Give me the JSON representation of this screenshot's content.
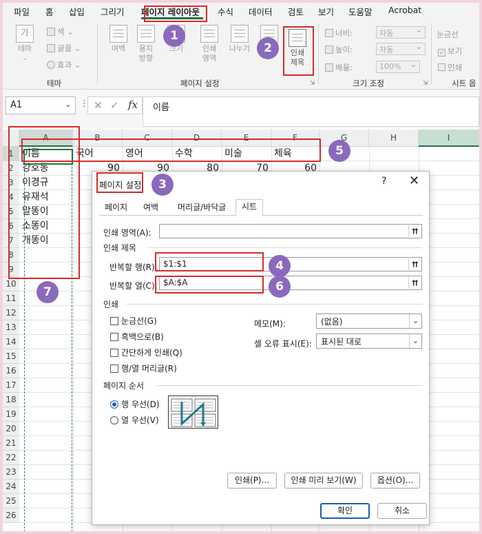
{
  "menu": {
    "tabs": [
      "파일",
      "홈",
      "삽입",
      "그리기",
      "페이지 레이아웃",
      "수식",
      "데이터",
      "검토",
      "보기",
      "도움말",
      "Acrobat"
    ],
    "active_tab": "페이지 레이아웃"
  },
  "ribbon": {
    "theme": {
      "theme_btn": "테마",
      "colors": "색",
      "fonts": "글꼴",
      "effects": "효과",
      "group_label": "테마",
      "font_icon_text": "가"
    },
    "page_setup": {
      "margins": "여백",
      "orientation": "용지\n방향",
      "size": "크기",
      "print_area": "인쇄\n영역",
      "breaks": "나누기",
      "background": "배경",
      "print_titles": "인쇄\n제목",
      "group_label": "페이지 설정"
    },
    "scale": {
      "width_label": "너비:",
      "width_val": "자동",
      "height_label": "높이:",
      "height_val": "자동",
      "scale_label": "배율:",
      "scale_val": "100%",
      "group_label": "크기 조정"
    },
    "sheet_options": {
      "gridlines": "눈금선",
      "view": "보기",
      "print": "인쇄",
      "group_label": "시트 옵"
    }
  },
  "formula_bar": {
    "name_box": "A1",
    "dots": "⋮",
    "cancel": "✕",
    "enter": "✓",
    "fx": "fx",
    "formula": "이름"
  },
  "sheet": {
    "columns": [
      "A",
      "B",
      "C",
      "D",
      "E",
      "F",
      "G",
      "H",
      "I"
    ],
    "rows": [
      "1",
      "2",
      "3",
      "4",
      "5",
      "6",
      "7",
      "8",
      "9",
      "10",
      "11",
      "12",
      "13",
      "14",
      "15",
      "16",
      "17",
      "18",
      "19",
      "20",
      "21",
      "22",
      "23",
      "24",
      "25",
      "26"
    ],
    "header_row": [
      "이름",
      "국어",
      "영어",
      "수학",
      "미술",
      "체육"
    ],
    "row2_values": [
      "90",
      "90",
      "80",
      "70",
      "60"
    ],
    "names": [
      "강호동",
      "이경규",
      "유재석",
      "말똥이",
      "소똥이",
      "개똥이"
    ]
  },
  "dialog": {
    "title": "페이지 설정",
    "help": "?",
    "close": "✕",
    "tabs": [
      "페이지",
      "여백",
      "머리글/바닥글",
      "시트"
    ],
    "active_tab": "시트",
    "print_area_label": "인쇄 영역(A):",
    "print_area_value": "",
    "print_titles_section": "인쇄 제목",
    "repeat_rows_label": "반복할 행(R):",
    "repeat_rows_value": "$1:$1",
    "repeat_cols_label": "반복할 열(C):",
    "repeat_cols_value": "$A:$A",
    "print_section": "인쇄",
    "gridlines": "눈금선(G)",
    "black_white": "흑백으로(B)",
    "draft": "간단하게 인쇄(Q)",
    "headings": "행/열 머리글(R)",
    "comments_label": "메모(M):",
    "comments_value": "(없음)",
    "errors_label": "셀 오류 표시(E):",
    "errors_value": "표시된 대로",
    "page_order_section": "페이지 순서",
    "down_then_over": "행 우선(D)",
    "over_then_down": "열 우선(V)",
    "print_button": "인쇄(P)...",
    "preview_button": "인쇄 미리 보기(W)",
    "options_button": "옵션(O)...",
    "ok_button": "확인",
    "cancel_button": "취소",
    "up_glyph": "⮅",
    "down_glyph": "⌄"
  },
  "annotations": [
    "1",
    "2",
    "3",
    "4",
    "5",
    "6",
    "7"
  ],
  "colors": {
    "accent": "#217346",
    "red_box": "#d42b2b",
    "badge": "#8b69bd",
    "dialog_primary": "#1a5fb4"
  }
}
